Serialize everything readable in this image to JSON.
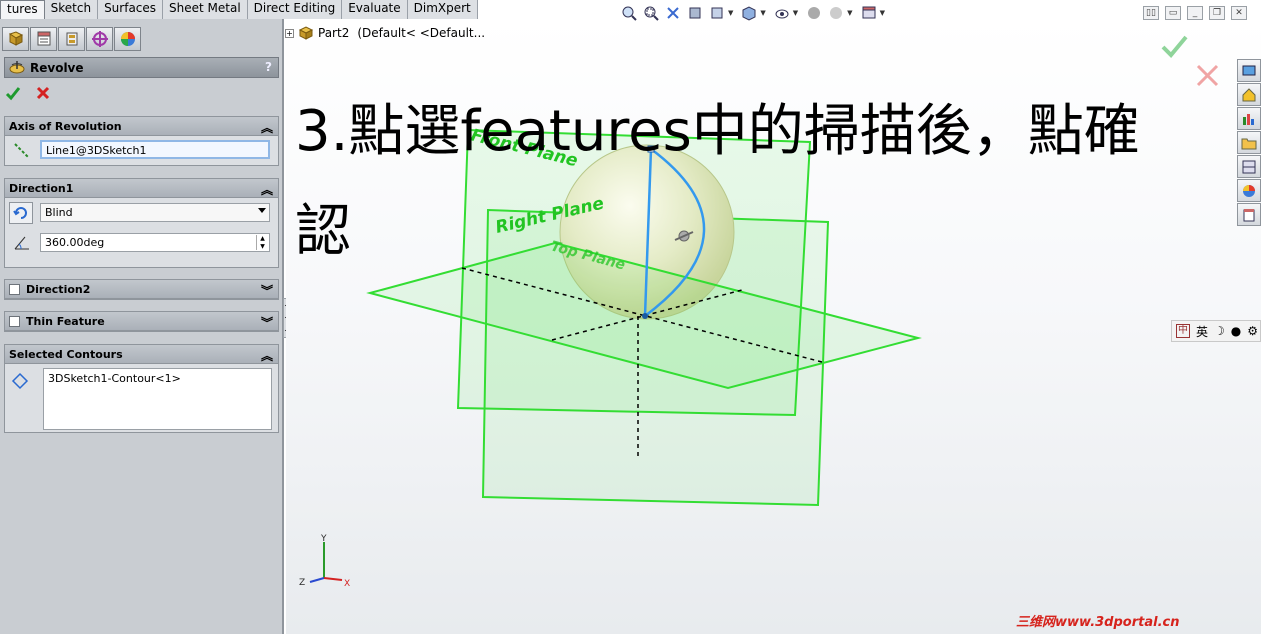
{
  "command_tabs": [
    "tures",
    "Sketch",
    "Surfaces",
    "Sheet Metal",
    "Direct Editing",
    "Evaluate",
    "DimXpert"
  ],
  "property_manager": {
    "title": "Revolve",
    "help": "?",
    "axis_group": {
      "title": "Axis of Revolution",
      "value": "Line1@3DSketch1"
    },
    "direction1_group": {
      "title": "Direction1",
      "type": "Blind",
      "angle": "360.00deg"
    },
    "direction2_group": {
      "title": "Direction2"
    },
    "thin_group": {
      "title": "Thin Feature"
    },
    "contours_group": {
      "title": "Selected Contours",
      "items": [
        "3DSketch1-Contour<1>"
      ]
    }
  },
  "feature_tree": {
    "label": "Part2",
    "config": "(Default< <Default..."
  },
  "scene": {
    "plane_labels": [
      "Front Plane",
      "Right Plane",
      "Top Plane"
    ],
    "triad": {
      "x": "X",
      "y": "Y",
      "z": "Z"
    },
    "plane_color": "#33dd33",
    "sketch_color": "#3399ee"
  },
  "overlay": {
    "line1": "3.點選features中的掃描後，點確",
    "line2": "認"
  },
  "ime": {
    "lang": "英"
  },
  "watermark": "三维网www.3dportal.cn"
}
